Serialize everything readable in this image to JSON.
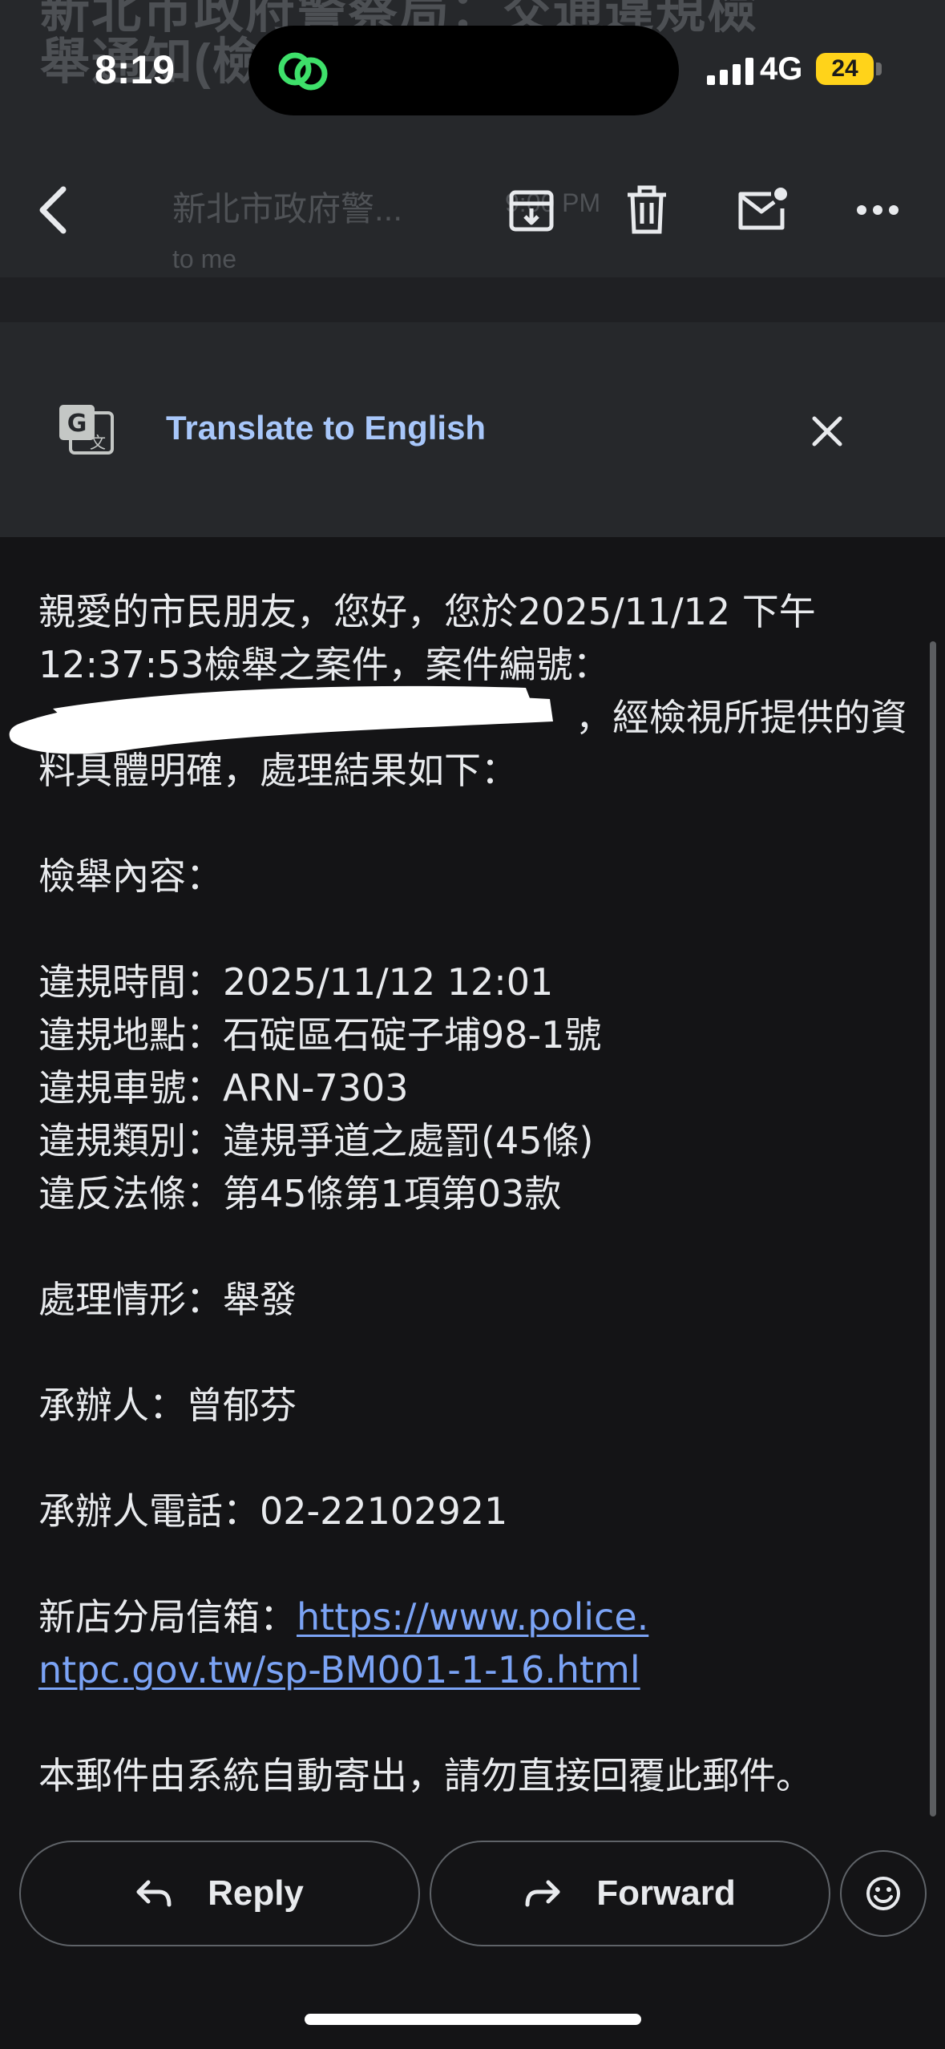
{
  "status_bar": {
    "time": "8:19",
    "network": "4G",
    "battery": "24",
    "battery_level_percent": 24,
    "activity_icon": "link-icon"
  },
  "header": {
    "subject_line1": "新北市政府警察局：交通違規檢",
    "subject_line2": "舉通知(檢",
    "sender": "新北市政府警...",
    "time_hint": "9:00 PM",
    "sender_sub": "to me",
    "icons": {
      "back": "back-arrow-icon",
      "archive": "archive-icon",
      "delete": "trash-icon",
      "mark_unread": "mark-unread-icon",
      "more": "more-icon"
    }
  },
  "translate": {
    "label": "Translate to English",
    "icon": "translate-icon",
    "close_icon": "close-icon"
  },
  "email": {
    "intro_line1": "親愛的市民朋友，您好，您於2025/11/12 下午",
    "intro_line2": "12:37:53檢舉之案件，案件編號：",
    "intro_line3_tail": "，經檢視所提供的資",
    "intro_line4": "料具體明確，處理結果如下：",
    "content_heading": "檢舉內容：",
    "violation_time": "違規時間：2025/11/12 12:01",
    "violation_location": "違規地點：石碇區石碇子埔98-1號",
    "violation_plate": "違規車號：ARN-7303",
    "violation_type": "違規類別：違規爭道之處罰(45條)",
    "violation_law": "違反法條：第45條第1項第03款",
    "handling_status": "處理情形：舉發",
    "officer": "承辦人：曾郁芬",
    "officer_phone": "承辦人電話：02-22102921",
    "mailbox_label": "新店分局信箱：",
    "mailbox_link_line1": "https://www.police.",
    "mailbox_link_line2": "ntpc.gov.tw/sp-BM001-1-16.html",
    "footer_note": "本郵件由系統自動寄出，請勿直接回覆此郵件。"
  },
  "actions": {
    "reply_label": "Reply",
    "forward_label": "Forward",
    "reply_icon": "reply-icon",
    "forward_icon": "forward-icon",
    "emoji_icon": "emoji-icon"
  },
  "colors": {
    "background": "#141416",
    "header": "#26282b",
    "link": "#7ba3f5",
    "translate_label": "#a8c7fa",
    "battery": "#ffd31a",
    "island_icon": "#3ee06a"
  }
}
